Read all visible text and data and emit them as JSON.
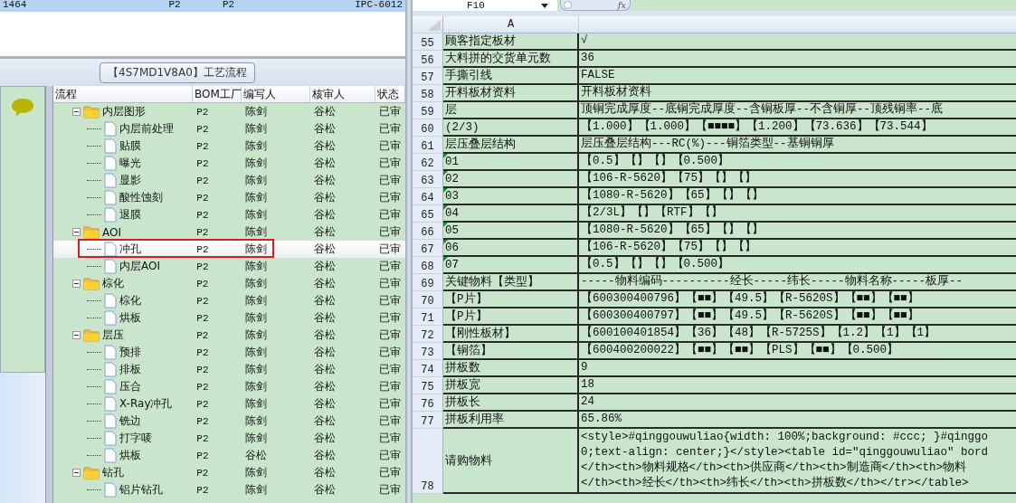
{
  "top_table": {
    "row": {
      "selected": true,
      "cells": [
        "1464",
        "P2",
        "P2",
        "IPC-6012"
      ]
    }
  },
  "flow_tab": {
    "label": "【4S7MD1V8A0】工艺流程"
  },
  "tree_grid": {
    "columns": [
      "流程",
      "BOM工厂",
      "编写人",
      "核审人",
      "状态"
    ],
    "rows": [
      {
        "kind": "folder",
        "expanded": true,
        "selected": false,
        "name": "内层图形",
        "bom": "P2",
        "writer": "陈剑",
        "reviewer": "谷松",
        "status": "已审",
        "children": [
          {
            "selected": false,
            "name": "内层前处理",
            "bom": "P2",
            "writer": "陈剑",
            "reviewer": "谷松",
            "status": "已审"
          },
          {
            "selected": false,
            "name": "贴膜",
            "bom": "P2",
            "writer": "陈剑",
            "reviewer": "谷松",
            "status": "已审"
          },
          {
            "selected": false,
            "name": "曝光",
            "bom": "P2",
            "writer": "陈剑",
            "reviewer": "谷松",
            "status": "已审"
          },
          {
            "selected": false,
            "name": "显影",
            "bom": "P2",
            "writer": "陈剑",
            "reviewer": "谷松",
            "status": "已审"
          },
          {
            "selected": false,
            "name": "酸性蚀刻",
            "bom": "P2",
            "writer": "陈剑",
            "reviewer": "谷松",
            "status": "已审"
          },
          {
            "selected": false,
            "name": "退膜",
            "bom": "P2",
            "writer": "陈剑",
            "reviewer": "谷松",
            "status": "已审"
          }
        ]
      },
      {
        "kind": "folder",
        "expanded": true,
        "selected": false,
        "name": "AOI",
        "bom": "P2",
        "writer": "陈剑",
        "reviewer": "谷松",
        "status": "已审",
        "children": [
          {
            "selected": true,
            "name": "冲孔",
            "bom": "P2",
            "writer": "陈剑",
            "reviewer": "谷松",
            "status": "已审"
          },
          {
            "selected": false,
            "name": "内层AOI",
            "bom": "P2",
            "writer": "陈剑",
            "reviewer": "谷松",
            "status": "已审"
          }
        ]
      },
      {
        "kind": "folder",
        "expanded": true,
        "selected": false,
        "name": "棕化",
        "bom": "P2",
        "writer": "陈剑",
        "reviewer": "谷松",
        "status": "已审",
        "children": [
          {
            "selected": false,
            "name": "棕化",
            "bom": "P2",
            "writer": "陈剑",
            "reviewer": "谷松",
            "status": "已审"
          },
          {
            "selected": false,
            "name": "烘板",
            "bom": "P2",
            "writer": "陈剑",
            "reviewer": "谷松",
            "status": "已审"
          }
        ]
      },
      {
        "kind": "folder",
        "expanded": true,
        "selected": false,
        "name": "层压",
        "bom": "P2",
        "writer": "陈剑",
        "reviewer": "谷松",
        "status": "已审",
        "children": [
          {
            "selected": false,
            "name": "预排",
            "bom": "P2",
            "writer": "陈剑",
            "reviewer": "谷松",
            "status": "已审"
          },
          {
            "selected": false,
            "name": "排板",
            "bom": "P2",
            "writer": "陈剑",
            "reviewer": "谷松",
            "status": "已审"
          },
          {
            "selected": false,
            "name": "压合",
            "bom": "P2",
            "writer": "陈剑",
            "reviewer": "谷松",
            "status": "已审"
          },
          {
            "selected": false,
            "name": "X-Ray冲孔",
            "bom": "P2",
            "writer": "陈剑",
            "reviewer": "谷松",
            "status": "已审"
          },
          {
            "selected": false,
            "name": "铣边",
            "bom": "P2",
            "writer": "陈剑",
            "reviewer": "谷松",
            "status": "已审"
          },
          {
            "selected": false,
            "name": "打字唛",
            "bom": "P2",
            "writer": "陈剑",
            "reviewer": "谷松",
            "status": "已审"
          },
          {
            "selected": false,
            "name": "烘板",
            "bom": "P2",
            "writer": "谷松",
            "reviewer": "谷松",
            "status": "已审"
          }
        ]
      },
      {
        "kind": "folder",
        "expanded": true,
        "selected": false,
        "name": "钻孔",
        "bom": "P2",
        "writer": "陈剑",
        "reviewer": "谷松",
        "status": "已审",
        "children": [
          {
            "selected": false,
            "name": "铝片钻孔",
            "bom": "P2",
            "writer": "陈剑",
            "reviewer": "谷松",
            "status": "已审"
          }
        ]
      }
    ]
  },
  "spreadsheet": {
    "name_box": "F10",
    "function_label": "fx",
    "columns": [
      "A"
    ],
    "rows": [
      {
        "number": "55",
        "a": "顾客指定板材",
        "flag": false,
        "b": [
          "√"
        ]
      },
      {
        "number": "56",
        "a": "大料拼的交货单元数",
        "flag": false,
        "b": [
          "36"
        ]
      },
      {
        "number": "57",
        "a": "手撕引线",
        "flag": false,
        "b": [
          "FALSE"
        ]
      },
      {
        "number": "58",
        "a": "开料板材资料",
        "flag": false,
        "b": [
          "开料板材资料"
        ]
      },
      {
        "number": "59",
        "a": "层",
        "flag": false,
        "b": [
          "顶铜完成厚度--底铜完成厚度--含铜板厚--不含铜厚--顶残铜率--底"
        ]
      },
      {
        "number": "60",
        "a": "(2/3)",
        "flag": false,
        "b": [
          "【1.000】【1.000】【■■■■】【1.200】【73.636】【73.544】"
        ]
      },
      {
        "number": "61",
        "a": "层压叠层结构",
        "flag": false,
        "b": [
          "层压叠层结构---RC(%)---铜箔类型--基铜铜厚"
        ]
      },
      {
        "number": "62",
        "a": "01",
        "flag": true,
        "b": [
          "【0.5】【】【】【0.500】"
        ]
      },
      {
        "number": "63",
        "a": "02",
        "flag": true,
        "b": [
          "【106-R-5620】【75】【】【】"
        ]
      },
      {
        "number": "64",
        "a": "03",
        "flag": true,
        "b": [
          "【1080-R-5620】【65】【】【】"
        ]
      },
      {
        "number": "65",
        "a": "04",
        "flag": true,
        "b": [
          "【2/3L】【】【RTF】【】"
        ]
      },
      {
        "number": "66",
        "a": "05",
        "flag": true,
        "b": [
          "【1080-R-5620】【65】【】【】"
        ]
      },
      {
        "number": "67",
        "a": "06",
        "flag": true,
        "b": [
          "【106-R-5620】【75】【】【】"
        ]
      },
      {
        "number": "68",
        "a": "07",
        "flag": true,
        "b": [
          "【0.5】【】【】【0.500】"
        ]
      },
      {
        "number": "69",
        "a": "关键物料【类型】",
        "flag": false,
        "b": [
          "-----物料编码----------经长-----纬长-----物料名称-----板厚--"
        ]
      },
      {
        "number": "70",
        "a": "【P片】",
        "flag": false,
        "b": [
          "【600300400796】【■■】【49.5】【R-5620S】【■■】【■■】"
        ]
      },
      {
        "number": "71",
        "a": "【P片】",
        "flag": false,
        "b": [
          "【600300400797】【■■】【49.5】【R-5620S】【■■】【■■】"
        ]
      },
      {
        "number": "72",
        "a": "【刚性板材】",
        "flag": false,
        "b": [
          "【600100401854】【36】【48】【R-5725S】【1.2】【1】【1】"
        ]
      },
      {
        "number": "73",
        "a": "【铜箔】",
        "flag": false,
        "b": [
          "【600400200022】【■■】【■■】【PLS】【■■】【0.500】"
        ]
      },
      {
        "number": "74",
        "a": "拼板数",
        "flag": false,
        "b": [
          "9"
        ]
      },
      {
        "number": "75",
        "a": "拼板宽",
        "flag": false,
        "b": [
          "18"
        ]
      },
      {
        "number": "76",
        "a": "拼板长",
        "flag": false,
        "b": [
          "24"
        ]
      },
      {
        "number": "77",
        "a": "拼板利用率",
        "flag": false,
        "b": [
          "65.86%"
        ]
      },
      {
        "number": "78",
        "a": "请购物料",
        "flag": false,
        "b": [
          "<style>#qinggouwuliao{width: 100%;background: #ccc; }#qinggo",
          "0;text-align: center;}</style><table id=\"qinggouwuliao\" bord",
          "</th><th>物料规格</th><th>供应商</th><th>制造商</th><th>物料",
          "</th><th>经长</th><th>纬长</th><th>拼板数</th></tr></table>"
        ]
      }
    ]
  }
}
